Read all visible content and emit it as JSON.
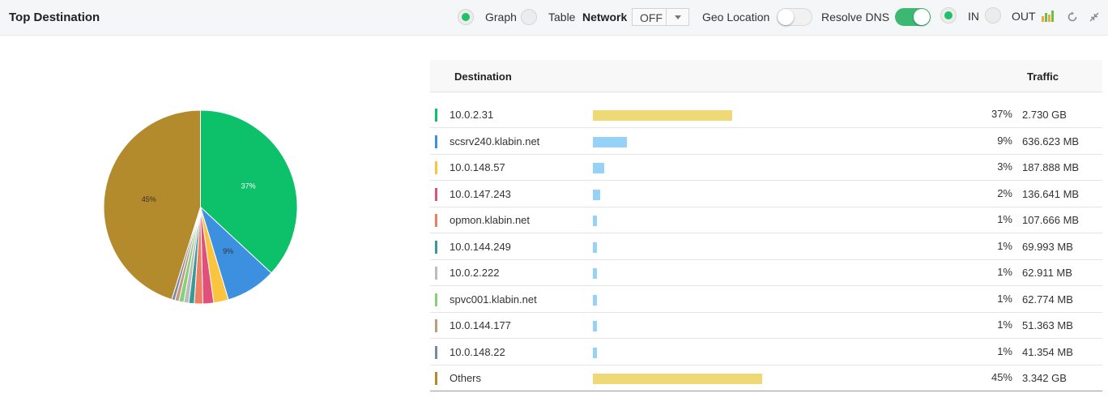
{
  "header": {
    "title": "Top Destination",
    "graph_label": "Graph",
    "table_label": "Table",
    "network_label": "Network",
    "network_value": "OFF",
    "geo_label": "Geo Location",
    "dns_label": "Resolve DNS",
    "in_label": "IN",
    "out_label": "OUT"
  },
  "table": {
    "col_destination": "Destination",
    "col_traffic": "Traffic",
    "rows": [
      {
        "name": "10.0.2.31",
        "pct": "37%",
        "size": "2.730 GB",
        "color": "#0cc16a",
        "bar": 0.37,
        "bar_color": "#efd977"
      },
      {
        "name": "scsrv240.klabin.net",
        "pct": "9%",
        "size": "636.623 MB",
        "color": "#3d8fe0",
        "bar": 0.09,
        "bar_color": "#96d2f7"
      },
      {
        "name": "10.0.148.57",
        "pct": "3%",
        "size": "187.888 MB",
        "color": "#fbc43e",
        "bar": 0.03,
        "bar_color": "#96d2f7"
      },
      {
        "name": "10.0.147.243",
        "pct": "2%",
        "size": "136.641 MB",
        "color": "#e0507a",
        "bar": 0.02,
        "bar_color": "#96d2f7"
      },
      {
        "name": "opmon.klabin.net",
        "pct": "1%",
        "size": "107.666 MB",
        "color": "#f07e63",
        "bar": 0.01,
        "bar_color": "#96d2f7"
      },
      {
        "name": "10.0.144.249",
        "pct": "1%",
        "size": "69.993 MB",
        "color": "#3a9b96",
        "bar": 0.01,
        "bar_color": "#96d2f7"
      },
      {
        "name": "10.0.2.222",
        "pct": "1%",
        "size": "62.911 MB",
        "color": "#bcbcbc",
        "bar": 0.01,
        "bar_color": "#96d2f7"
      },
      {
        "name": "spvc001.klabin.net",
        "pct": "1%",
        "size": "62.774 MB",
        "color": "#86d07a",
        "bar": 0.01,
        "bar_color": "#96d2f7"
      },
      {
        "name": "10.0.144.177",
        "pct": "1%",
        "size": "51.363 MB",
        "color": "#c49a7f",
        "bar": 0.01,
        "bar_color": "#96d2f7"
      },
      {
        "name": "10.0.148.22",
        "pct": "1%",
        "size": "41.354 MB",
        "color": "#7a87a6",
        "bar": 0.01,
        "bar_color": "#96d2f7"
      },
      {
        "name": "Others",
        "pct": "45%",
        "size": "3.342 GB",
        "color": "#b38b2d",
        "bar": 0.45,
        "bar_color": "#efd977"
      }
    ]
  },
  "chart_data": {
    "type": "pie",
    "categories": [
      "10.0.2.31",
      "scsrv240.klabin.net",
      "10.0.148.57",
      "10.0.147.243",
      "opmon.klabin.net",
      "10.0.144.249",
      "10.0.2.222",
      "spvc001.klabin.net",
      "10.0.144.177",
      "10.0.148.22",
      "Others"
    ],
    "values": [
      2.73,
      0.622,
      0.183,
      0.133,
      0.105,
      0.068,
      0.061,
      0.061,
      0.05,
      0.04,
      3.342
    ],
    "labels": [
      "37%",
      "9%",
      "",
      "",
      "",
      "",
      "",
      "",
      "",
      "",
      "45%"
    ],
    "colors": [
      "#0cc16a",
      "#3d8fe0",
      "#fbc43e",
      "#e0507a",
      "#f07e63",
      "#3a9b96",
      "#bcbcbc",
      "#86d07a",
      "#c49a7f",
      "#7a87a6",
      "#b38b2d"
    ]
  }
}
